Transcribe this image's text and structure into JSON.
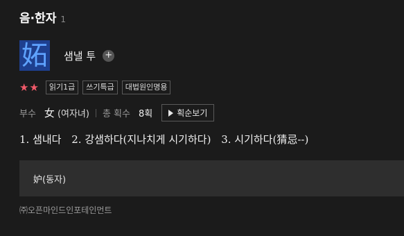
{
  "header": {
    "title": "음·한자",
    "count": "1"
  },
  "entry": {
    "hanja": "妬",
    "meaning": "샘낼 투",
    "add_label": "+",
    "stars": "★★",
    "tags": [
      "읽기1급",
      "쓰기특급",
      "대법원인명용"
    ],
    "radical_label": "부수",
    "radical_char": "女",
    "radical_desc": "(여자녀)",
    "strokes_label": "총 획수",
    "strokes_value": "8획",
    "stroke_order_button": "획순보기",
    "definitions": [
      "1. 샘내다",
      "2. 강샘하다(지나치게 시기하다)",
      "3. 시기하다(猜忌--)"
    ],
    "related": "妒(동자)"
  },
  "footer": {
    "copyright": "㈜오픈마인드인포테인먼트"
  },
  "colors": {
    "background": "#1b1b1b",
    "hanja_bg": "#1e3f8f",
    "hanja_fg": "#5fa3ff",
    "stars": "#f25a6a",
    "panel": "#2e2e2e"
  },
  "icons": {
    "add": "plus-circle-icon",
    "play": "play-icon"
  }
}
